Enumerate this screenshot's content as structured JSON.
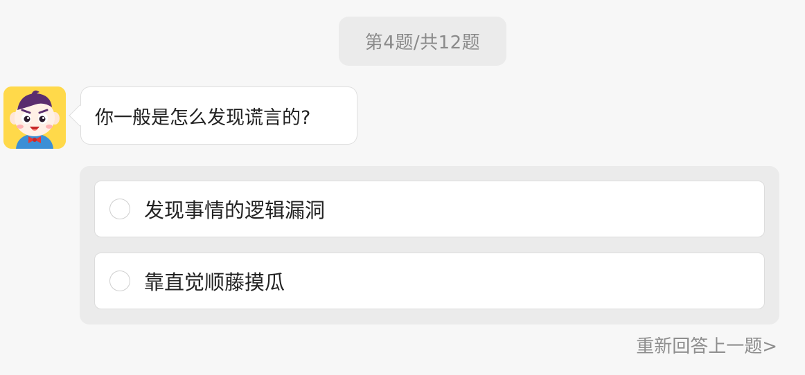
{
  "progress": {
    "label": "第4题/共12题"
  },
  "avatar": {
    "icon": "cartoon-boy-avatar-icon",
    "background": "#ffd94a"
  },
  "question": {
    "text": "你一般是怎么发现谎言的?"
  },
  "options": [
    {
      "label": "发现事情的逻辑漏洞",
      "selected": false
    },
    {
      "label": "靠直觉顺藤摸瓜",
      "selected": false
    }
  ],
  "footer": {
    "redo_label": "重新回答上一题>"
  }
}
